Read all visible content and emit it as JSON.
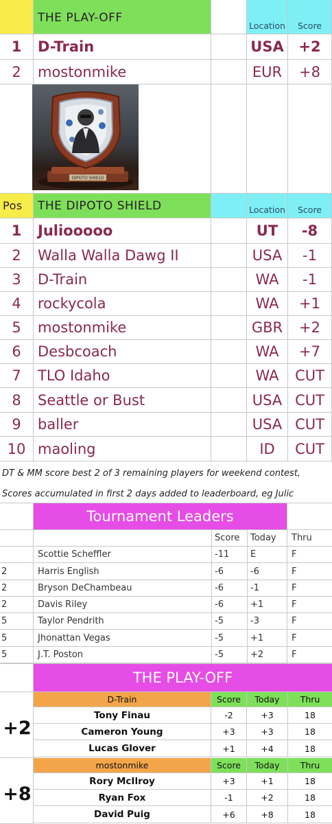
{
  "playoff_top": {
    "title": "THE PLAY-OFF",
    "col_location": "Location",
    "col_score": "Score",
    "rows": [
      {
        "pos": "1",
        "name": "D-Train",
        "loc": "USA",
        "score": "+2"
      },
      {
        "pos": "2",
        "name": "mostonmike",
        "loc": "EUR",
        "score": "+8"
      }
    ]
  },
  "trophy": {
    "plaque_text": "DIPOTO SHIELD"
  },
  "shield": {
    "col_pos": "Pos",
    "title": "THE DIPOTO SHIELD",
    "col_location": "Location",
    "col_score": "Score",
    "rows": [
      {
        "pos": "1",
        "name": "Juliooooo",
        "loc": "UT",
        "score": "-8"
      },
      {
        "pos": "2",
        "name": "Walla Walla Dawg II",
        "loc": "USA",
        "score": "-1"
      },
      {
        "pos": "3",
        "name": "D-Train",
        "loc": "WA",
        "score": "-1"
      },
      {
        "pos": "4",
        "name": "rockycola",
        "loc": "WA",
        "score": "+1"
      },
      {
        "pos": "5",
        "name": "mostonmike",
        "loc": "GBR",
        "score": "+2"
      },
      {
        "pos": "6",
        "name": "Desbcoach",
        "loc": "WA",
        "score": "+7"
      },
      {
        "pos": "7",
        "name": "TLO Idaho",
        "loc": "WA",
        "score": "CUT"
      },
      {
        "pos": "8",
        "name": "Seattle or Bust",
        "loc": "USA",
        "score": "CUT"
      },
      {
        "pos": "9",
        "name": "baller",
        "loc": "USA",
        "score": "CUT"
      },
      {
        "pos": "10",
        "name": "maoling",
        "loc": "ID",
        "score": "CUT"
      }
    ]
  },
  "notes": [
    "DT & MM score best 2 of 3 remaining players for weekend contest,",
    "Scores accumulated in first 2 days added to leaderboard, eg Julic"
  ],
  "leaders": {
    "title": "Tournament Leaders",
    "col_score": "Score",
    "col_today": "Today",
    "col_thru": "Thru",
    "rows": [
      {
        "pos": "",
        "name": "Scottie Scheffler",
        "score": "-11",
        "today": "E",
        "thru": "F"
      },
      {
        "pos": "2",
        "name": "Harris English",
        "score": "-6",
        "today": "-6",
        "thru": "F"
      },
      {
        "pos": "2",
        "name": "Bryson DeChambeau",
        "score": "-6",
        "today": "-1",
        "thru": "F"
      },
      {
        "pos": "2",
        "name": "Davis Riley",
        "score": "-6",
        "today": "+1",
        "thru": "F"
      },
      {
        "pos": "5",
        "name": "Taylor Pendrith",
        "score": "-5",
        "today": "-3",
        "thru": "F"
      },
      {
        "pos": "5",
        "name": "Jhonattan Vegas",
        "score": "-5",
        "today": "+1",
        "thru": "F"
      },
      {
        "pos": "5",
        "name": "J.T. Poston",
        "score": "-5",
        "today": "+2",
        "thru": "F"
      }
    ]
  },
  "playoff_bottom": {
    "title": "THE PLAY-OFF",
    "teams": [
      {
        "name": "D-Train",
        "total": "+2",
        "col_score": "Score",
        "col_today": "Today",
        "col_thru": "Thru",
        "players": [
          {
            "name": "Tony Finau",
            "score": "-2",
            "today": "+3",
            "thru": "18"
          },
          {
            "name": "Cameron Young",
            "score": "+3",
            "today": "+3",
            "thru": "18"
          },
          {
            "name": "Lucas Glover",
            "score": "+1",
            "today": "+4",
            "thru": "18"
          }
        ]
      },
      {
        "name": "mostonmike",
        "total": "+8",
        "col_score": "Score",
        "col_today": "Today",
        "col_thru": "Thru",
        "players": [
          {
            "name": "Rory McIlroy",
            "score": "+3",
            "today": "+1",
            "thru": "18"
          },
          {
            "name": "Ryan Fox",
            "score": "-1",
            "today": "+2",
            "thru": "18"
          },
          {
            "name": "David Puig",
            "score": "+6",
            "today": "+8",
            "thru": "18"
          }
        ]
      }
    ]
  },
  "colors": {
    "green": "#7ee05a",
    "cyan": "#7ef0f5",
    "yellow": "#f8ec4a",
    "magenta": "#e64ce6",
    "orange": "#f3a54a",
    "maroon": "#8a2a4a"
  }
}
